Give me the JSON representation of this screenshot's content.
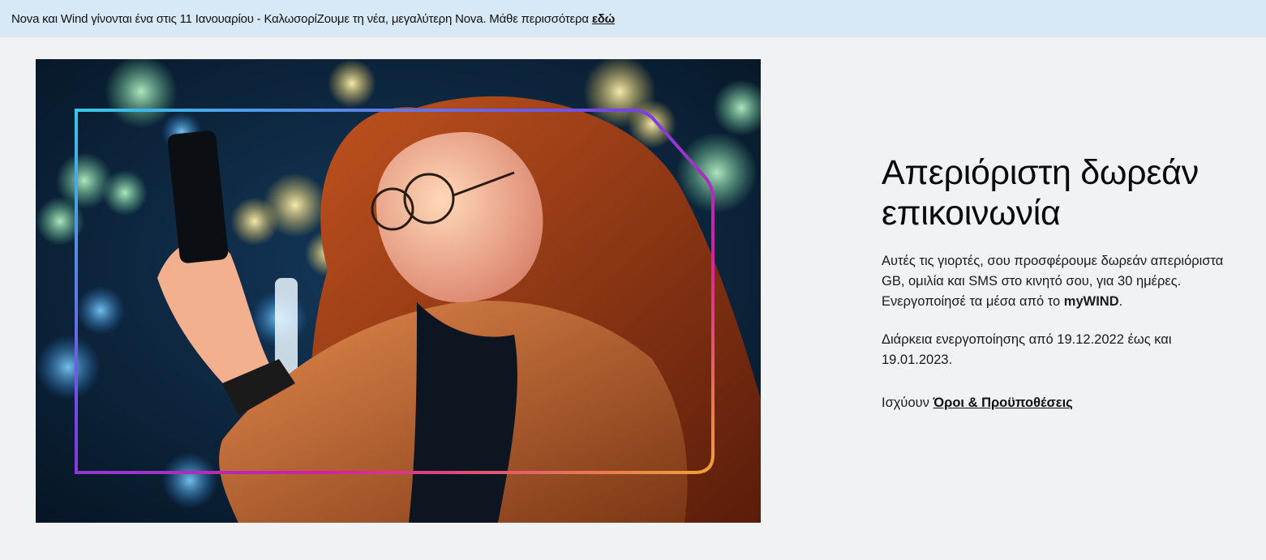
{
  "banner": {
    "text": "Nova και Wind γίνονται ένα στις 11 Ιανουαρίου - ΚαλωσορίΖουμε τη νέα, μεγαλύτερη Nova. Μάθε περισσότερα",
    "link_label": "εδώ"
  },
  "hero": {
    "image_alt": "",
    "frame_gradient": [
      "#39c6e8",
      "#7b3fe4",
      "#d61f9e",
      "#f0a233"
    ]
  },
  "content": {
    "title": "Απεριόριστη δωρεάν επικοινωνία",
    "paragraph1_text": "Αυτές τις γιορτές, σου προσφέρουμε δωρεάν απεριόριστα GB, ομιλία και SMS στο κινητό σου, για 30 ημέρες. Ενεργοποίησέ τα μέσα από το ",
    "paragraph1_bold": "myWIND",
    "paragraph1_end": ".",
    "paragraph2": "Διάρκεια ενεργοποίησης από 19.12.2022 έως και 19.01.2023.",
    "terms_prefix": "Ισχύουν",
    "terms_link": "Όροι & Προϋποθέσεις"
  },
  "colors": {
    "banner_bg": "#d7e8f6",
    "page_bg": "#f1f2f4",
    "text": "#111111"
  }
}
